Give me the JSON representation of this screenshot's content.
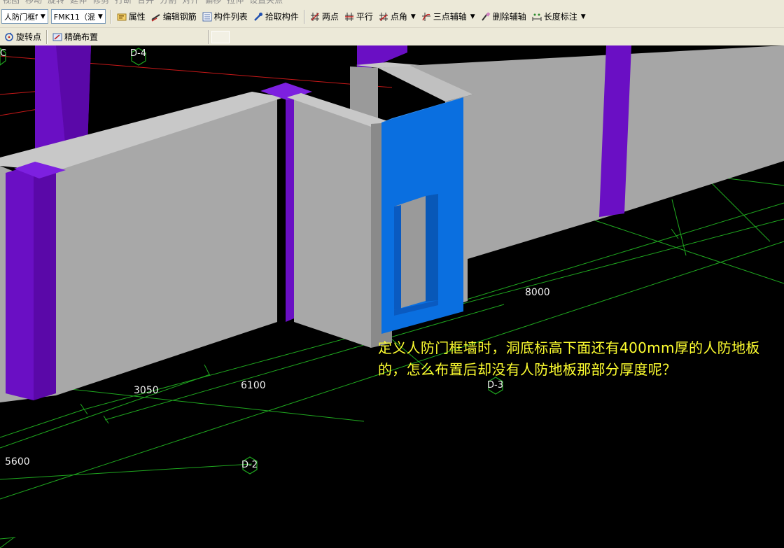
{
  "toolbar_top": {
    "items": [
      "视图",
      "移动",
      "旋转",
      "延伸",
      "修剪",
      "打断",
      "合并",
      "分割",
      "对齐",
      "偏移",
      "拉伸",
      "设置夹点"
    ]
  },
  "toolbar1": {
    "layer_select": "人防门框f",
    "component_select": "FMK11（混",
    "buttons": {
      "properties": "属性",
      "edit_rebar": "编辑钢筋",
      "component_list": "构件列表",
      "pick_component": "拾取构件",
      "two_points": "两点",
      "parallel": "平行",
      "point_angle": "点角",
      "three_point_axis": "三点辅轴",
      "delete_axis": "删除辅轴",
      "length_dimension": "长度标注"
    }
  },
  "toolbar2": {
    "rotate_point": "旋转点",
    "precise_layout": "精确布置"
  },
  "viewport": {
    "axis_labels": {
      "c": "C",
      "d4": "D-4",
      "d3": "D-3",
      "d2": "D-2"
    },
    "dimensions": {
      "d8000": "8000",
      "d3050": "3050",
      "d6100": "6100",
      "d5600": "5600"
    },
    "note": "定义人防门框墙时，洞底标高下面还有400mm厚的人防地板的，怎么布置后却没有人防地板那部分厚度呢？"
  },
  "colors": {
    "background": "#000000",
    "wall": "#a6a6a6",
    "column": "#6a0fc4",
    "door_frame": "#0a6fe0",
    "grid_green": "#1fa81f",
    "grid_red": "#c81818",
    "note_text": "#ffff30"
  }
}
